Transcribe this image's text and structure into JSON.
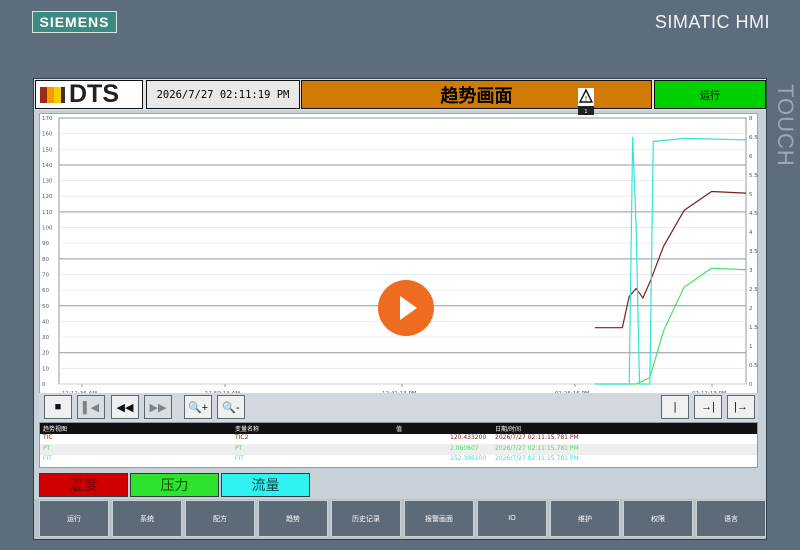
{
  "device": {
    "brand": "SIEMENS",
    "model": "SIMATIC HMI",
    "side_label": "TOUCH"
  },
  "header": {
    "logo_text": "DTS",
    "datetime": "2026/7/27 02:11:19 PM",
    "title": "趋势画面",
    "status": "运行",
    "colors": {
      "title_bg": "#d07b05",
      "status_bg": "#00d000"
    }
  },
  "chart_data": {
    "type": "line",
    "y_left_ticks": [
      "170",
      "160",
      "150",
      "140",
      "130",
      "120",
      "110",
      "100",
      "90",
      "80",
      "70",
      "60",
      "50",
      "40",
      "30",
      "20",
      "10",
      "0"
    ],
    "y_right_ticks": [
      "8",
      "6.5",
      "6",
      "5.5",
      "5",
      "4.5",
      "4",
      "3.5",
      "3",
      "2.5",
      "2",
      "1.5",
      "1",
      "0.5",
      "0"
    ],
    "x_ticks": [
      {
        "time": "11:11:36 AM",
        "date": "2026/7/27"
      },
      {
        "time": "11:50:13 AM",
        "date": "2026/7/27"
      },
      {
        "time": "12:41:13 PM",
        "date": "2026/7/27"
      },
      {
        "time": "01:26:16 PM",
        "date": "2026/7/27"
      },
      {
        "time": "02:11:13 PM",
        "date": "2026/7/27"
      }
    ],
    "series": [
      {
        "name": "TIC",
        "color": "#7b1e1e",
        "values": [
          [
            0.78,
            36
          ],
          [
            0.82,
            36
          ],
          [
            0.83,
            56
          ],
          [
            0.84,
            61
          ],
          [
            0.85,
            55
          ],
          [
            0.86,
            65
          ],
          [
            0.88,
            88
          ],
          [
            0.91,
            111
          ],
          [
            0.95,
            123
          ],
          [
            1.0,
            122
          ]
        ]
      },
      {
        "name": "PT",
        "color": "#46e25e",
        "values": [
          [
            0.78,
            0
          ],
          [
            0.84,
            0
          ],
          [
            0.86,
            4
          ],
          [
            0.88,
            34
          ],
          [
            0.91,
            62
          ],
          [
            0.95,
            74
          ],
          [
            1.0,
            73
          ]
        ]
      },
      {
        "name": "FIT",
        "color": "#32e6d2",
        "values": [
          [
            0.78,
            0
          ],
          [
            0.83,
            0
          ],
          [
            0.835,
            158
          ],
          [
            0.84,
            102
          ],
          [
            0.845,
            0
          ],
          [
            0.86,
            0
          ],
          [
            0.865,
            155
          ],
          [
            0.91,
            157
          ],
          [
            1.0,
            156
          ]
        ]
      }
    ]
  },
  "controls": {
    "buttons": [
      "■",
      "▌◀",
      "◀◀",
      "▶▶",
      "🔍+",
      "🔍-",
      "|",
      "→|",
      "|→"
    ]
  },
  "table": {
    "headers": [
      "趋势视图",
      "变量名称",
      "值",
      "日期/时间"
    ],
    "rows": [
      {
        "trend": "TIC",
        "variable": "TIC2",
        "value": "120.433200",
        "datetime": "2026/7/27 02:11:15.781 PM"
      },
      {
        "trend": "PT",
        "variable": "PT",
        "value": "2.060607",
        "datetime": "2026/7/27 02:11:15.781 PM"
      },
      {
        "trend": "FIT",
        "variable": "FIT",
        "value": "152.396100",
        "datetime": "2026/7/27 02:11:15.781 PM"
      }
    ]
  },
  "legend": [
    {
      "label": "温度",
      "bg": "#d00000",
      "fg": "#6b0000"
    },
    {
      "label": "压力",
      "bg": "#2ee32e",
      "fg": "#124d12"
    },
    {
      "label": "流量",
      "bg": "#2ff3f1",
      "fg": "#0c4948"
    }
  ],
  "navigation": [
    "运行",
    "系统",
    "配方",
    "趋势",
    "历史记录",
    "报警画面",
    "IO",
    "维护",
    "权限",
    "语言"
  ]
}
